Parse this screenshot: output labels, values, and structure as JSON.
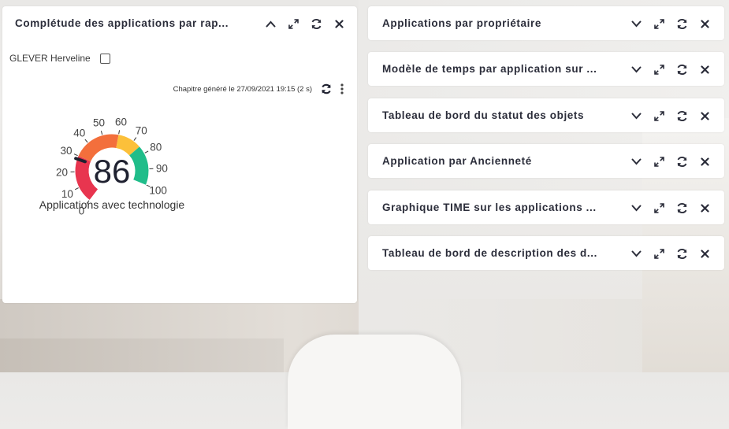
{
  "main_panel": {
    "title": "Complétude des applications par rap...",
    "user_label": "GLEVER Herveline",
    "generated_text": "Chapitre généré le 27/09/2021 19:15 (2 s)"
  },
  "chart_data": {
    "type": "gauge",
    "value": 86,
    "value_label": "86",
    "min": 0,
    "max": 100,
    "ticks": [
      "0",
      "10",
      "20",
      "30",
      "40",
      "50",
      "60",
      "70",
      "80",
      "90",
      "100"
    ],
    "label": "Applications avec technologie",
    "bands": [
      {
        "from": 0,
        "to": 30,
        "color": "#e8354f"
      },
      {
        "from": 30,
        "to": 60,
        "color": "#f36f3c"
      },
      {
        "from": 60,
        "to": 75,
        "color": "#fcc03a"
      },
      {
        "from": 75,
        "to": 100,
        "color": "#20bd8a"
      }
    ],
    "needle_color": "#1f2130"
  },
  "right_panels": [
    {
      "title": "Applications par propriétaire"
    },
    {
      "title": "Modèle de temps par application sur ..."
    },
    {
      "title": "Tableau de bord du statut des objets"
    },
    {
      "title": "Application par Ancienneté"
    },
    {
      "title": "Graphique TIME sur les applications ..."
    },
    {
      "title": "Tableau de bord de description des d..."
    }
  ],
  "colors": {
    "title_text": "#2b2d3a",
    "icon": "#2b2d3a"
  },
  "icons": {
    "collapse": "chevron-up-icon",
    "expand_panel": "chevron-down-icon",
    "maximize": "expand-icon",
    "refresh": "refresh-icon",
    "close": "close-icon",
    "menu": "kebab-menu-icon"
  }
}
